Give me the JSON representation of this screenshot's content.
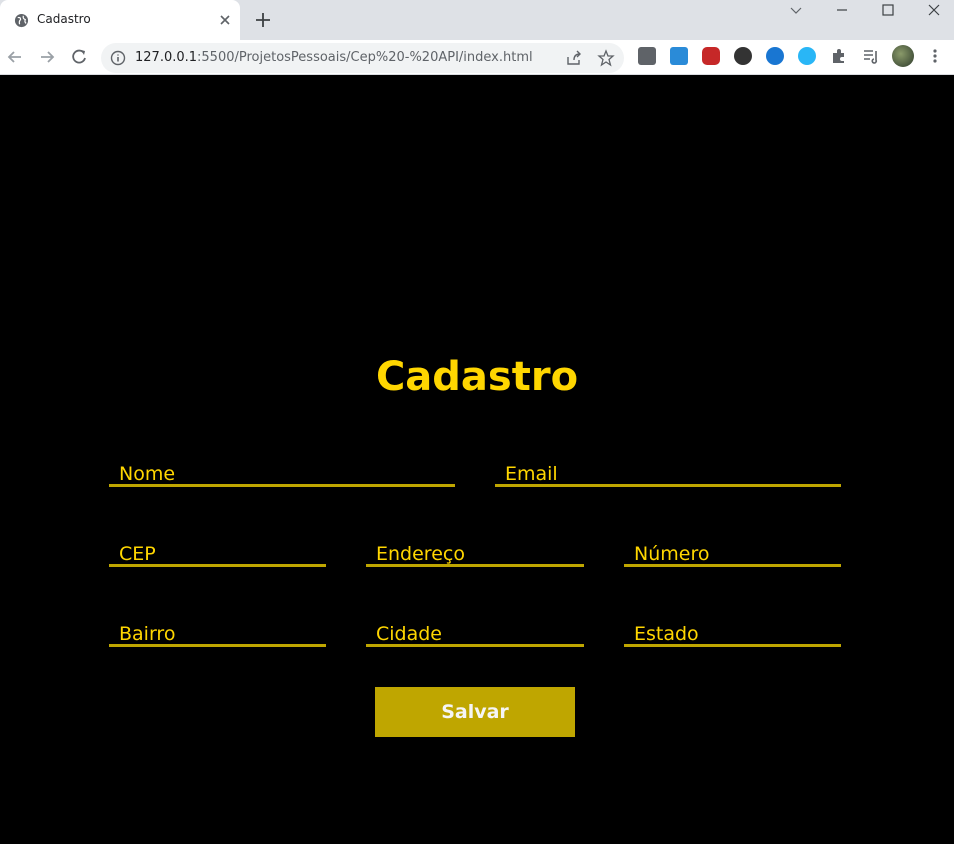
{
  "browser": {
    "tab_title": "Cadastro",
    "url_host": "127.0.0.1",
    "url_rest": ":5500/ProjetosPessoais/Cep%20-%20API/index.html"
  },
  "form": {
    "title": "Cadastro",
    "fields": {
      "nome": "Nome",
      "email": "Email",
      "cep": "CEP",
      "endereco": "Endereço",
      "numero": "Número",
      "bairro": "Bairro",
      "cidade": "Cidade",
      "estado": "Estado"
    },
    "save_label": "Salvar"
  },
  "colors": {
    "accent": "#ffd600",
    "button": "#bfa600",
    "background": "#000000"
  }
}
